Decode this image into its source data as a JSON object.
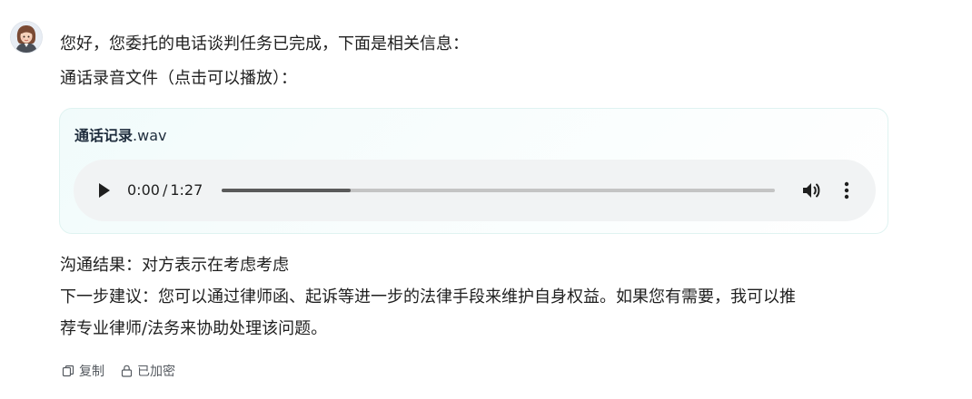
{
  "message": {
    "greeting": "您好，您委托的电话谈判任务已完成，下面是相关信息：",
    "recording_intro": "通话录音文件（点击可以播放）："
  },
  "audio": {
    "file_stem": "通话记录",
    "file_ext": ".wav",
    "current_time": "0:00",
    "separator": "/",
    "duration": "1:27",
    "progress_fraction": 0.233,
    "icons": {
      "play": "play-icon",
      "volume": "volume-icon",
      "more": "more-vertical-icon"
    }
  },
  "result": {
    "outcome": "沟通结果：对方表示在考虑考虑",
    "suggestion_line1": "下一步建议：您可以通过律师函、起诉等进一步的法律手段来维护自身权益。如果您有需要，我可以推",
    "suggestion_line2": "荐专业律师/法务来协助处理该问题。"
  },
  "actions": {
    "copy_label": "复制",
    "encrypted_label": "已加密",
    "icons": {
      "copy": "copy-icon",
      "lock": "lock-icon"
    }
  },
  "colors": {
    "card_border": "#dff3f1",
    "card_tint": "#f1fbfb",
    "player_bg": "#f1f3f4",
    "progress_fill": "#5a5a5a",
    "progress_track": "#c4c4c4"
  }
}
